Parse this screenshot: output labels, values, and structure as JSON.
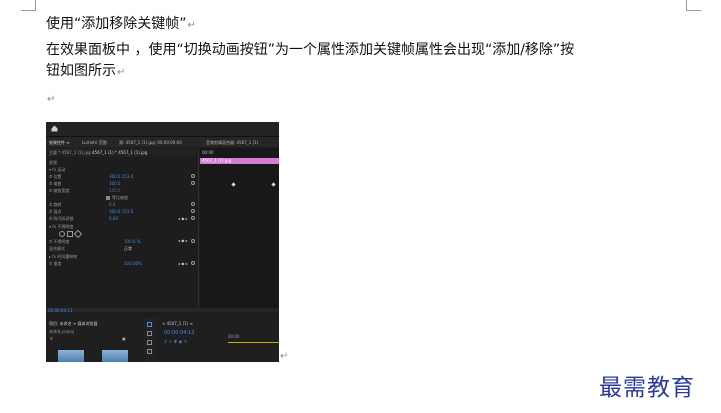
{
  "document": {
    "heading": "使用“添加移除关键帧”",
    "body_line1": "在效果面板中 ，使用“切换动画按钮”为一个属性添加关键帧属性会出现“添加/移除”按",
    "body_line2": "钮如图所示",
    "para_mark": "↵",
    "empty_mark": "↵"
  },
  "screenshot": {
    "tabs": [
      "效果控件 ≡",
      "Lumetri 范围",
      "源: 4567_1 (1).jpg: 00:00:00:00",
      "音频剪辑混合器: 4567_1 (1)"
    ],
    "subtabs": [
      "主要 * 4567_1 (1).jpg",
      "4567_1 (1) * 4567_1 (1).jpg"
    ],
    "rows": [
      {
        "label": "视频",
        "value": ""
      },
      {
        "label": "▾ fx 运动",
        "value": ""
      },
      {
        "label": "   ⏱ 位置",
        "value": "360.0   153.0"
      },
      {
        "label": "   ⏱ 缩放",
        "value": "100.0"
      },
      {
        "label": "   ⏱ 缩放宽度",
        "value": "100.0"
      },
      {
        "label": "",
        "value": "等比缩放"
      },
      {
        "label": "   ⏱ 旋转",
        "value": "0.0"
      },
      {
        "label": "   ⏱ 锚点",
        "value": "360.0   153.0"
      },
      {
        "label": "   ⏱ 防闪烁滤镜",
        "value": "0.00"
      },
      {
        "label": "▾ fx 不透明度",
        "value": ""
      },
      {
        "label": "   ⏱ 不透明度",
        "value": "100.0 %"
      },
      {
        "label": "   混合模式",
        "value": "正常"
      },
      {
        "label": "▸ fx 时间重映射",
        "value": ""
      },
      {
        "label": "   ⏱ 速度",
        "value": "100.00%"
      }
    ],
    "timeline_time": "00:00",
    "timeline_clip": "4567_1 (1).jpg",
    "bottom_timecode": "00:00:04:13",
    "project_tab": "项目: 未命名 ≡   媒体浏览器",
    "project_file": "未命名.prproj",
    "sequence_tab": "× 4567_1 (1) ≡",
    "sequence_timecode": "00:00:04:13",
    "sequence_ruler": "00:00"
  },
  "watermark": "最需教育"
}
